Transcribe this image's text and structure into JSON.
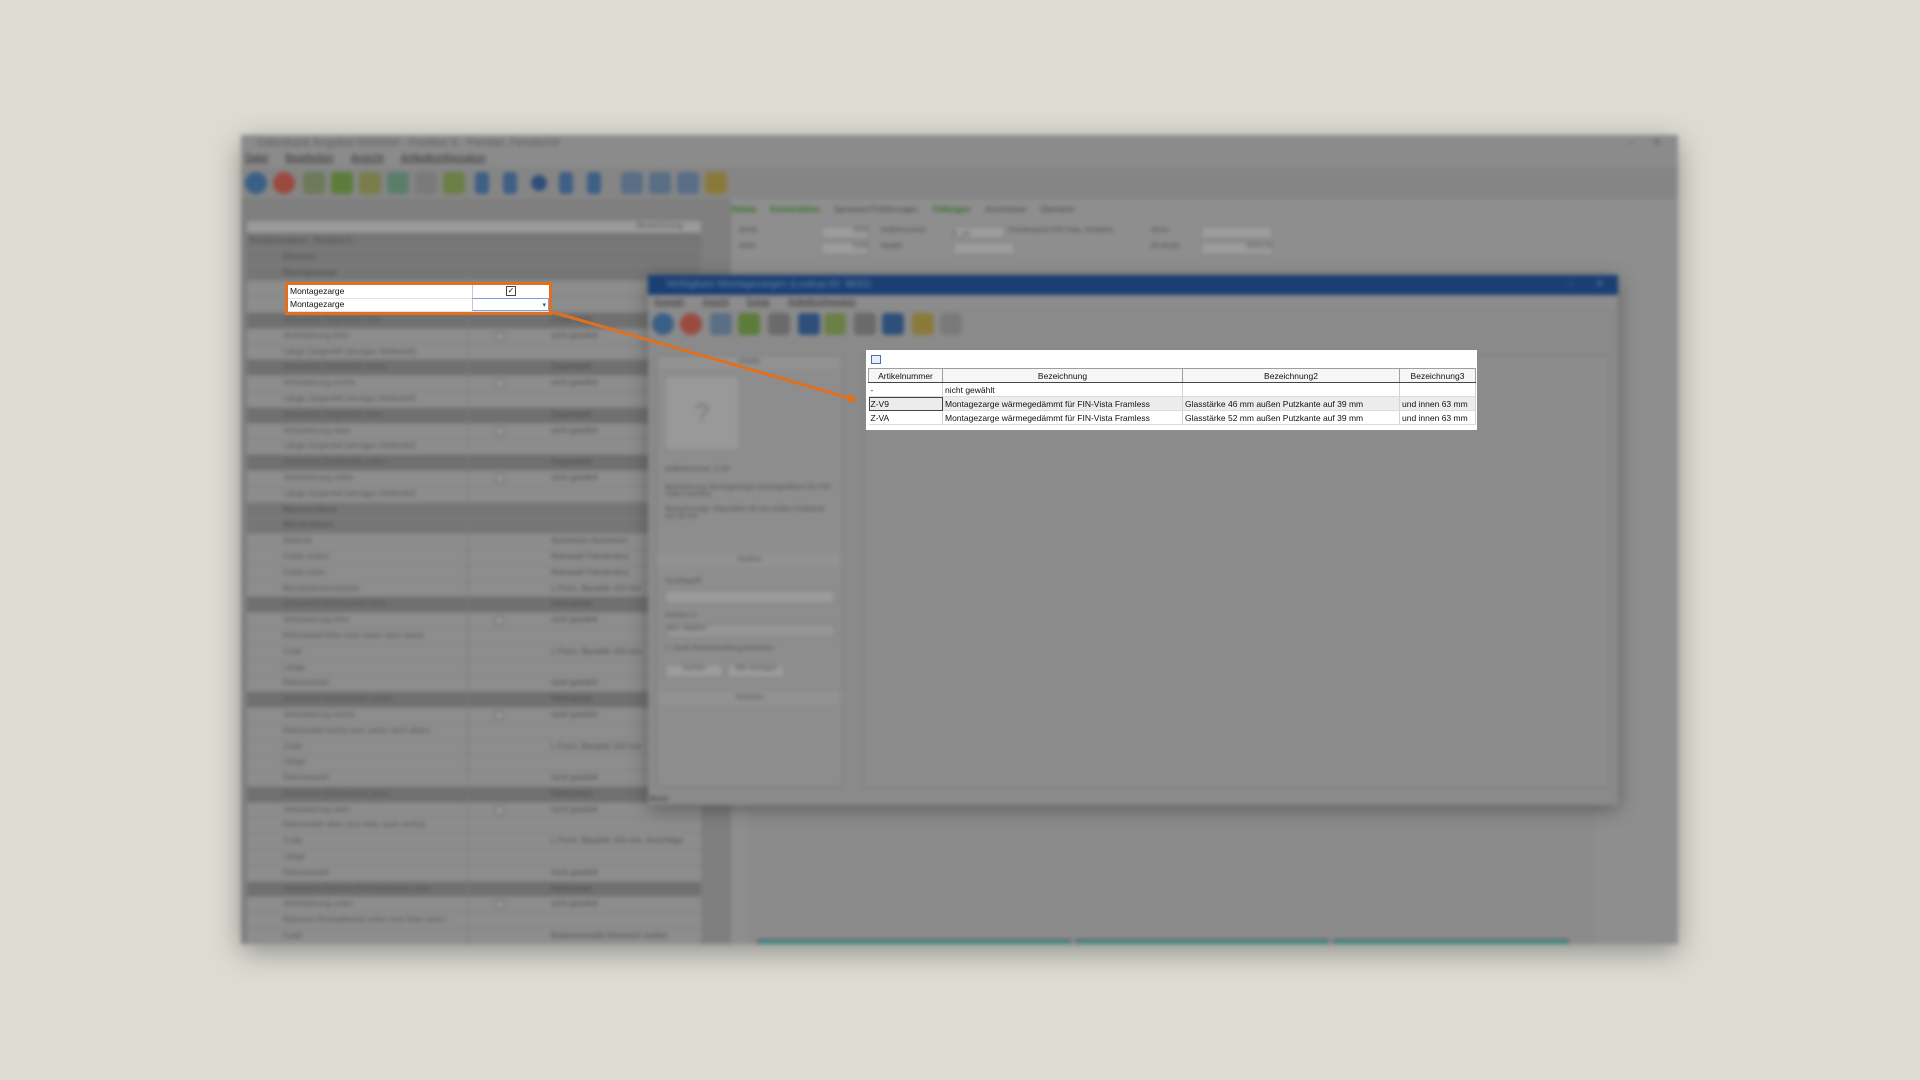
{
  "background_app": {
    "title": "Datenbank Angebot 0000000 - Position 6 - Fenster, Fenstertür",
    "menu": [
      "Datei",
      "Bearbeiten",
      "Ansicht",
      "Artikelkonfiguration"
    ],
    "grid_header": "Bezeichnung",
    "grid_title": "Positionsdaten - Position 6",
    "grid_rows": [
      {
        "label": "Element",
        "type": "cat"
      },
      {
        "label": "Montagezarge",
        "type": "cat"
      },
      {
        "label": "",
        "type": "row"
      },
      {
        "label": "",
        "type": "row"
      },
      {
        "label": "Anbauteile Zargenteile links",
        "type": "sec",
        "value": "Zargenblatt"
      },
      {
        "label": "Verbreiterung links",
        "type": "row",
        "check": true,
        "value": "nicht gewählt"
      },
      {
        "label": "Länge Zargenteil (einziges Nebenteil)",
        "type": "row"
      },
      {
        "label": "Anbauteile Zargenteile rechts",
        "type": "sec",
        "value": "Zargenblatt"
      },
      {
        "label": "Verbreiterung rechts",
        "type": "row",
        "check": true,
        "value": "nicht gewählt"
      },
      {
        "label": "Länge Zargenteil (einziges Nebenteil)",
        "type": "row"
      },
      {
        "label": "Anbauteile Zargenteile oben",
        "type": "sec",
        "value": "Zargenblatt"
      },
      {
        "label": "Verbreiterung oben",
        "type": "row",
        "check": true,
        "value": "nicht gewählt"
      },
      {
        "label": "Länge Zargenteil (einziges Nebenteil)",
        "type": "row"
      },
      {
        "label": "Anbauteile Zargenteile unten",
        "type": "sec",
        "value": "Zargenblatt"
      },
      {
        "label": "Verbreiterung unten",
        "type": "row",
        "check": true,
        "value": "nicht gewählt"
      },
      {
        "label": "Länge Zargenteil (einziges Nebenteil)",
        "type": "row"
      },
      {
        "label": "Bauanschluss",
        "type": "cat"
      },
      {
        "label": "Blendrahmen",
        "type": "cat"
      },
      {
        "label": "Material",
        "type": "row",
        "value": "Aluminium Aluminium"
      },
      {
        "label": "Farbe außen",
        "type": "row",
        "value": "Reinweiß Feinstruktur"
      },
      {
        "label": "Farbe innen",
        "type": "row",
        "value": "Reinweiß Feinstruktur"
      },
      {
        "label": "Blendrahmenvariante",
        "type": "row",
        "value": "L-Form, Bautiefe 100 mm"
      },
      {
        "label": "Anbauteile Rahmenteile links",
        "type": "sec",
        "value": "Rahmenteil"
      },
      {
        "label": "Verbreiterung links",
        "type": "row",
        "check": true,
        "value": "nicht gewählt"
      },
      {
        "label": "Rahmenteil links (von unten nach oben)",
        "type": "row"
      },
      {
        "label": "Code",
        "type": "row",
        "value": "L-Form, Bautiefe 100 mm"
      },
      {
        "label": "Länge",
        "type": "row"
      },
      {
        "label": "Rahmenstoß",
        "type": "row",
        "value": "nicht gewählt"
      },
      {
        "label": "Anbauteile Rahmenteile rechts",
        "type": "sec",
        "value": "Rahmenteil"
      },
      {
        "label": "Verbreiterung rechts",
        "type": "row",
        "check": true,
        "value": "nicht gewählt"
      },
      {
        "label": "Rahmenteil rechts (von unten nach oben)",
        "type": "row"
      },
      {
        "label": "Code",
        "type": "row",
        "value": "L-Form, Bautiefe 100 mm"
      },
      {
        "label": "Länge",
        "type": "row"
      },
      {
        "label": "Rahmenstoß",
        "type": "row",
        "value": "nicht gewählt"
      },
      {
        "label": "Anbauteile Rahmenteile oben",
        "type": "sec",
        "value": "Rahmenteil"
      },
      {
        "label": "Verbreiterung oben",
        "type": "row",
        "check": true,
        "value": "nicht gewählt"
      },
      {
        "label": "Rahmenteil oben (von links nach rechts)",
        "type": "row"
      },
      {
        "label": "Code",
        "type": "row",
        "value": "L-Form, Bautiefe 100 mm, Anschläge"
      },
      {
        "label": "Länge",
        "type": "row"
      },
      {
        "label": "Rahmenstoß",
        "type": "row",
        "value": "nicht gewählt"
      },
      {
        "label": "Anbauteile Rahmen-/Schwellenteile unten",
        "type": "sec",
        "value": "Rahmenteil"
      },
      {
        "label": "Verbreiterung unten",
        "type": "row",
        "check": true,
        "value": "nicht gewählt"
      },
      {
        "label": "Rahmen-/Schwellenteil unten (von links nach r",
        "type": "row"
      },
      {
        "label": "Code",
        "type": "row",
        "value": "Bodenschwelle thermisch isoliert"
      },
      {
        "label": "Länge",
        "type": "row"
      },
      {
        "label": "Rahmenstoß",
        "type": "row",
        "value": "nicht gewählt"
      }
    ],
    "right_tabs": [
      "Global",
      "Konstruktion",
      "Sprossen/Türführungen",
      "Füllungen",
      "Anschlüsse",
      "Übersicht"
    ],
    "form": {
      "breite_label": "Breite",
      "breite_value": "3000",
      "hoehe_label": "Höhe",
      "hoehe_value": "2300",
      "artikelnummer_label": "Artikelnummer",
      "artikelnummer_value": "F_00",
      "artikel_desc": "Fensterwand FIN-Vista, Schieben",
      "modell_label": "Modell",
      "stueck_label": "Stück",
      "brutto_label": "Ek Brutto",
      "brutto_value": "8000,00"
    }
  },
  "dialog": {
    "title": "Verfügbare Montagezargen (Lookup-ID: 9832)",
    "menu": [
      "Auswahl",
      "Ansicht",
      "Extras",
      "Artikelkonfiguration"
    ],
    "side": {
      "details_header": "Details",
      "info1": "Artikelnummer: Z-V9",
      "info2": "Bezeichnung: Montagezarge wärmegedämmt für FIN-Vista Framless",
      "info3": "Bezeichnung2: Glasstärke 46 mm außen Putzkante auf 39 mm",
      "suchen_header": "Suchen",
      "suchbegriff_label": "Suchbegriff",
      "suchen_in_label": "Suchen in",
      "suchen_in_value": "allen Spalten",
      "exact_label": "Groß-/Kleinschreibung beachten",
      "btn_suchen": "Suchen",
      "btn_alle": "Alle anzeigen",
      "sortieren_header": "Sortieren"
    },
    "status": "Bereit"
  },
  "highlight_rows": [
    {
      "label": "Montagezarge",
      "checked": true
    },
    {
      "label": "Montagezarge",
      "dropdown": true
    }
  ],
  "lookup_table": {
    "columns": [
      "Artikelnummer",
      "Bezeichnung",
      "Bezeichnung2",
      "Bezeichnung3"
    ],
    "rows": [
      [
        "-",
        "nicht gewählt",
        "",
        ""
      ],
      [
        "Z-V9",
        "Montagezarge wärmegedämmt für FIN-Vista Framless",
        "Glasstärke 46 mm außen Putzkante auf 39 mm",
        "und innen 63 mm"
      ],
      [
        "Z-VA",
        "Montagezarge wärmegedämmt für FIN-Vista Framless",
        "Glasstärke 52 mm außen Putzkante auf 39 mm",
        "und innen 63 mm"
      ]
    ],
    "selected_row": 1
  },
  "colors": {
    "highlight_border": "#e0701e",
    "arrow": "#e0701e",
    "backdrop": "#dcdcd3",
    "dialog_title": "#1a3f73"
  }
}
